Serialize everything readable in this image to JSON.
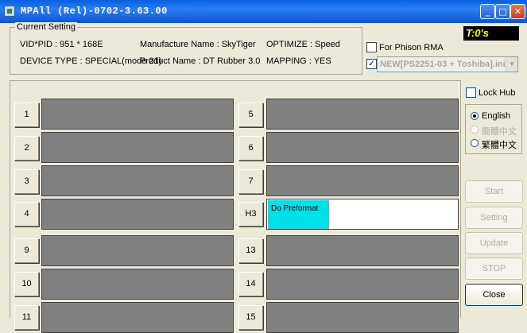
{
  "window": {
    "title": "MPAll (Rel)-0702-3.63.00",
    "minimize": "_",
    "maximize": "□",
    "close": "✕"
  },
  "current_setting": {
    "legend": "Current Setting",
    "vid_pid": "VID*PID :  951 * 168E",
    "manufacture": "Manufacture Name : SkyTiger",
    "optimize": "OPTIMIZE : Speed",
    "device_type": "DEVICE TYPE : SPECIAL(mode 21)",
    "product": "Product Name : DT Rubber 3.0",
    "mapping": "MAPPING : YES"
  },
  "timer": "T:0's",
  "for_phison_rma": {
    "label": "For Phison RMA",
    "checked": false
  },
  "new_combo": {
    "checked": true,
    "value": "NEW[PS2251-03 + Toshiba].ini"
  },
  "lock_hub": {
    "label": "Lock Hub",
    "checked": false
  },
  "languages": [
    {
      "label": "English",
      "checked": true,
      "enabled": true
    },
    {
      "label": "簡體中文",
      "checked": false,
      "enabled": false
    },
    {
      "label": "繁體中文",
      "checked": false,
      "enabled": true
    }
  ],
  "ports_left": [
    {
      "id": "1",
      "status": ""
    },
    {
      "id": "2",
      "status": ""
    },
    {
      "id": "3",
      "status": ""
    },
    {
      "id": "4",
      "status": ""
    },
    {
      "id": "9",
      "status": ""
    },
    {
      "id": "10",
      "status": ""
    },
    {
      "id": "11",
      "status": ""
    }
  ],
  "ports_right": [
    {
      "id": "5",
      "status": ""
    },
    {
      "id": "6",
      "status": ""
    },
    {
      "id": "7",
      "status": ""
    },
    {
      "id": "H3",
      "status": "Do Preformat",
      "progress": 0.32
    },
    {
      "id": "13",
      "status": ""
    },
    {
      "id": "14",
      "status": ""
    },
    {
      "id": "15",
      "status": ""
    }
  ],
  "buttons": {
    "start": "Start",
    "setting": "Setting",
    "update": "Update",
    "stop": "STOP",
    "close": "Close"
  },
  "colors": {
    "title_bar": "#0a5fe0",
    "idle_port": "#808080",
    "progress": "#00e0e8",
    "timer_text": "#ffff00"
  }
}
